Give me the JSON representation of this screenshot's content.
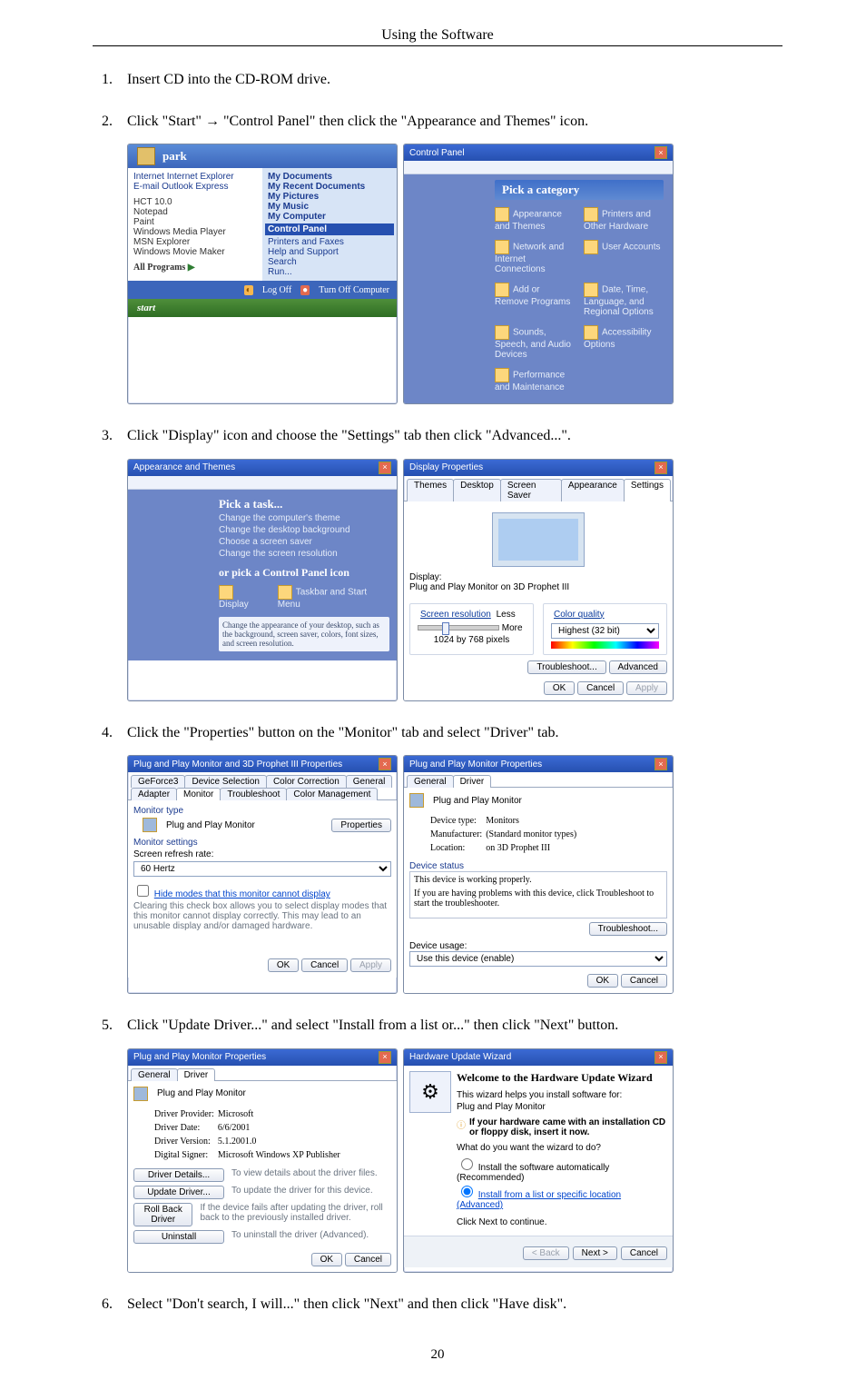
{
  "header_title": "Using the Software",
  "steps": {
    "s1": "Insert CD into the CD-ROM drive.",
    "s2": "Click \"Start\" → \"Control Panel\" then click the \"Appearance and Themes\" icon.",
    "s3": "Click \"Display\" icon and choose the \"Settings\" tab then click \"Advanced...\".",
    "s4": "Click the \"Properties\" button on the \"Monitor\" tab and select \"Driver\" tab.",
    "s5": "Click \"Update Driver...\" and select \"Install from a list or...\" then click \"Next\" button.",
    "s6": "Select \"Don't search, I will...\" then click \"Next\" and then click \"Have disk\"."
  },
  "start_menu": {
    "user": "park",
    "left": [
      "Internet Internet Explorer",
      "E-mail Outlook Express",
      "HCT 10.0",
      "Notepad",
      "Paint",
      "Windows Media Player",
      "MSN Explorer",
      "Windows Movie Maker",
      "All Programs"
    ],
    "right": [
      "My Documents",
      "My Recent Documents",
      "My Pictures",
      "My Music",
      "My Computer",
      "Control Panel",
      "Printers and Faxes",
      "Help and Support",
      "Search",
      "Run..."
    ],
    "logoff": "Log Off",
    "turnoff": "Turn Off Computer",
    "startbtn": "start"
  },
  "control_panel": {
    "title": "Control Panel",
    "heading": "Pick a category",
    "cats": [
      "Appearance and Themes",
      "Printers and Other Hardware",
      "Network and Internet Connections",
      "User Accounts",
      "Add or Remove Programs",
      "Date, Time, Language, and Regional Options",
      "Sounds, Speech, and Audio Devices",
      "Accessibility Options",
      "Performance and Maintenance"
    ]
  },
  "appearance_themes": {
    "title": "Appearance and Themes",
    "heading": "Pick a task...",
    "tasks": [
      "Change the computer's theme",
      "Change the desktop background",
      "Choose a screen saver",
      "Change the screen resolution"
    ],
    "or_heading": "or pick a Control Panel icon",
    "icons": [
      "Display",
      "Taskbar and Start Menu"
    ],
    "hint": "Change the appearance of your desktop, such as the background, screen saver, colors, font sizes, and screen resolution."
  },
  "display_props": {
    "title": "Display Properties",
    "tabs": [
      "Themes",
      "Desktop",
      "Screen Saver",
      "Appearance",
      "Settings"
    ],
    "display_label": "Display:",
    "display_value": "Plug and Play Monitor on 3D Prophet III",
    "res_label": "Screen resolution",
    "res_less": "Less",
    "res_more": "More",
    "res_value": "1024 by 768 pixels",
    "cq_label": "Color quality",
    "cq_value": "Highest (32 bit)",
    "btn_trouble": "Troubleshoot...",
    "btn_advanced": "Advanced",
    "ok": "OK",
    "cancel": "Cancel",
    "apply": "Apply"
  },
  "pnp_3d": {
    "title": "Plug and Play Monitor and 3D Prophet III Properties",
    "tabs": [
      "GeForce3",
      "Device Selection",
      "Color Correction",
      "General",
      "Adapter",
      "Monitor",
      "Troubleshoot",
      "Color Management"
    ],
    "mtype_h": "Monitor type",
    "mtype_v": "Plug and Play Monitor",
    "btn_properties": "Properties",
    "msettings_h": "Monitor settings",
    "refresh_label": "Screen refresh rate:",
    "refresh_value": "60 Hertz",
    "hide_label": "Hide modes that this monitor cannot display",
    "hide_hint": "Clearing this check box allows you to select display modes that this monitor cannot display correctly. This may lead to an unusable display and/or damaged hardware.",
    "ok": "OK",
    "cancel": "Cancel",
    "apply": "Apply"
  },
  "pnp_props": {
    "title": "Plug and Play Monitor Properties",
    "tabs": [
      "General",
      "Driver"
    ],
    "heading": "Plug and Play Monitor",
    "devtype_l": "Device type:",
    "devtype_v": "Monitors",
    "manu_l": "Manufacturer:",
    "manu_v": "(Standard monitor types)",
    "loc_l": "Location:",
    "loc_v": "on 3D Prophet III",
    "status_h": "Device status",
    "status_msg": "This device is working properly.",
    "status_hint": "If you are having problems with this device, click Troubleshoot to start the troubleshooter.",
    "btn_trouble": "Troubleshoot...",
    "usage_l": "Device usage:",
    "usage_v": "Use this device (enable)",
    "ok": "OK",
    "cancel": "Cancel"
  },
  "pnp_driver": {
    "title": "Plug and Play Monitor Properties",
    "tabs": [
      "General",
      "Driver"
    ],
    "heading": "Plug and Play Monitor",
    "prov_l": "Driver Provider:",
    "prov_v": "Microsoft",
    "date_l": "Driver Date:",
    "date_v": "6/6/2001",
    "ver_l": "Driver Version:",
    "ver_v": "5.1.2001.0",
    "sig_l": "Digital Signer:",
    "sig_v": "Microsoft Windows XP Publisher",
    "btn_details": "Driver Details...",
    "details_hint": "To view details about the driver files.",
    "btn_update": "Update Driver...",
    "update_hint": "To update the driver for this device.",
    "btn_rollback": "Roll Back Driver",
    "rollback_hint": "If the device fails after updating the driver, roll back to the previously installed driver.",
    "btn_uninstall": "Uninstall",
    "uninstall_hint": "To uninstall the driver (Advanced).",
    "ok": "OK",
    "cancel": "Cancel"
  },
  "hw_wizard": {
    "title": "Hardware Update Wizard",
    "welcome": "Welcome to the Hardware Update Wizard",
    "intro": "This wizard helps you install software for:",
    "device": "Plug and Play Monitor",
    "cd_hint": "If your hardware came with an installation CD or floppy disk, insert it now.",
    "q": "What do you want the wizard to do?",
    "opt1": "Install the software automatically (Recommended)",
    "opt2": "Install from a list or specific location (Advanced)",
    "cont": "Click Next to continue.",
    "back": "< Back",
    "next": "Next >",
    "cancel": "Cancel"
  },
  "page_number": "20"
}
